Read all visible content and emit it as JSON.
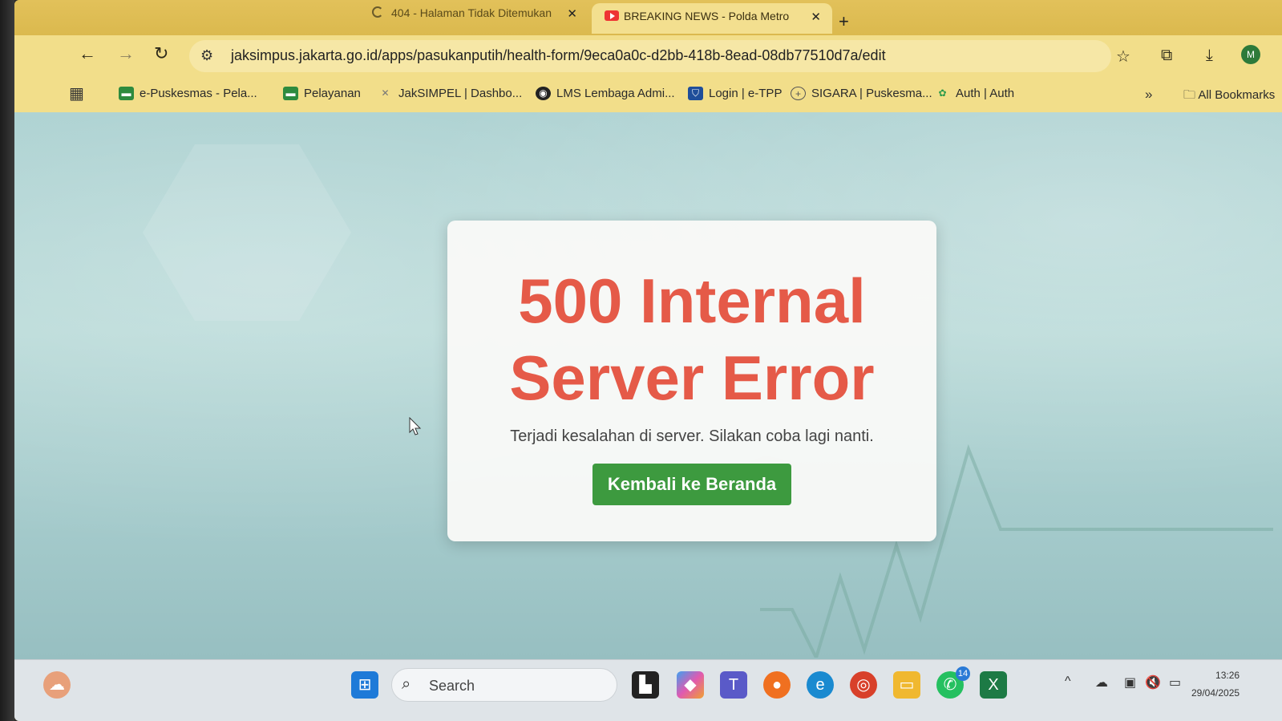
{
  "browser": {
    "tabs": [
      {
        "label": "404 - Halaman Tidak Ditemukan",
        "active": false
      },
      {
        "label": "BREAKING NEWS - Polda Metro",
        "active": true
      }
    ],
    "new_tab_label": "+",
    "url": "jaksimpus.jakarta.go.id/apps/pasukanputih/health-form/9eca0a0c-d2bb-418b-8ead-08db77510d7a/edit",
    "avatar_initial": "M",
    "bookmarks": [
      {
        "label": "e-Puskesmas - Pela...",
        "icon": "epuskesmas-icon",
        "color": "#2e8b3e"
      },
      {
        "label": "Pelayanan",
        "icon": "epuskesmas-icon",
        "color": "#2e8b3e"
      },
      {
        "label": "JakSIMPEL | Dashbo...",
        "icon": "jaksimpel-icon",
        "color": "#9aa0a6"
      },
      {
        "label": "LMS Lembaga Admi...",
        "icon": "globe-icon",
        "color": "#222222"
      },
      {
        "label": "Login | e-TPP",
        "icon": "shield-icon",
        "color": "#1f4e9a"
      },
      {
        "label": "SIGARA | Puskesma...",
        "icon": "sigara-icon",
        "color": "#555555"
      },
      {
        "label": "Auth | Auth",
        "icon": "auth-icon",
        "color": "#2a9a4a"
      }
    ],
    "all_bookmarks_label": "All Bookmarks"
  },
  "page": {
    "error_title_line1": "500 Internal",
    "error_title_line2": "Server Error",
    "error_message": "Terjadi kesalahan di server. Silakan coba lagi nanti.",
    "home_button_label": "Kembali ke Beranda",
    "accent_color": "#e55a48",
    "button_color": "#3d9a3f"
  },
  "taskbar": {
    "search_placeholder": "Search",
    "whatsapp_badge": "14",
    "time": "13:26",
    "date": "29/04/2025"
  }
}
